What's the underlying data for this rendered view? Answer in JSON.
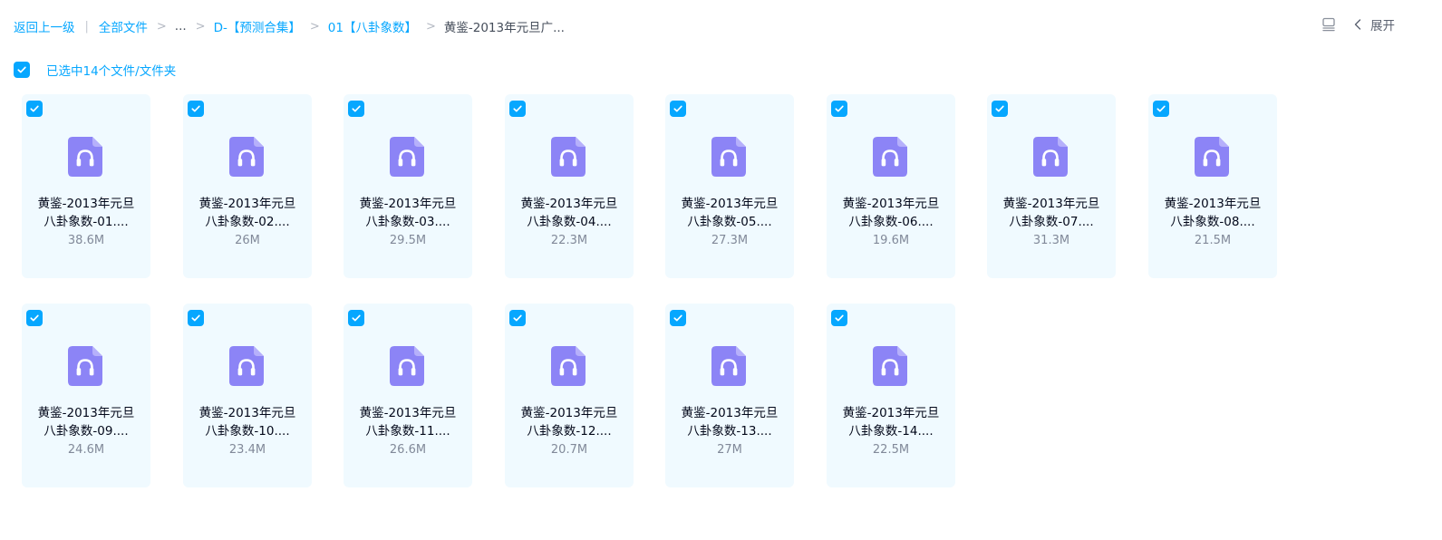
{
  "breadcrumb": {
    "back": "返回上一级",
    "all_files": "全部文件",
    "ellipsis": "...",
    "folder1": "D-【预测合集】",
    "folder2": "01【八卦象数】",
    "current": "黄鉴-2013年元旦广...",
    "separator": ">",
    "divider": "|"
  },
  "toolbar": {
    "expand_label": "展开",
    "layout_icon": "list-layout-icon",
    "expand_icon": "chevron-left-icon"
  },
  "selection": {
    "text": "已选中14个文件/文件夹",
    "checked": true
  },
  "colors": {
    "accent": "#06a7ff",
    "card_bg": "#f0faff",
    "file_icon": "#8c84f6"
  },
  "files": [
    {
      "line1": "黄鉴-2013年元旦",
      "line2": "八卦象数-01....",
      "size": "38.6M",
      "icon": "audio-file-icon",
      "checked": true
    },
    {
      "line1": "黄鉴-2013年元旦",
      "line2": "八卦象数-02....",
      "size": "26M",
      "icon": "audio-file-icon",
      "checked": true
    },
    {
      "line1": "黄鉴-2013年元旦",
      "line2": "八卦象数-03....",
      "size": "29.5M",
      "icon": "audio-file-icon",
      "checked": true
    },
    {
      "line1": "黄鉴-2013年元旦",
      "line2": "八卦象数-04....",
      "size": "22.3M",
      "icon": "audio-file-icon",
      "checked": true
    },
    {
      "line1": "黄鉴-2013年元旦",
      "line2": "八卦象数-05....",
      "size": "27.3M",
      "icon": "audio-file-icon",
      "checked": true
    },
    {
      "line1": "黄鉴-2013年元旦",
      "line2": "八卦象数-06....",
      "size": "19.6M",
      "icon": "audio-file-icon",
      "checked": true
    },
    {
      "line1": "黄鉴-2013年元旦",
      "line2": "八卦象数-07....",
      "size": "31.3M",
      "icon": "audio-file-icon",
      "checked": true
    },
    {
      "line1": "黄鉴-2013年元旦",
      "line2": "八卦象数-08....",
      "size": "21.5M",
      "icon": "audio-file-icon",
      "checked": true
    },
    {
      "line1": "黄鉴-2013年元旦",
      "line2": "八卦象数-09....",
      "size": "24.6M",
      "icon": "audio-file-icon",
      "checked": true
    },
    {
      "line1": "黄鉴-2013年元旦",
      "line2": "八卦象数-10....",
      "size": "23.4M",
      "icon": "audio-file-icon",
      "checked": true
    },
    {
      "line1": "黄鉴-2013年元旦",
      "line2": "八卦象数-11....",
      "size": "26.6M",
      "icon": "audio-file-icon",
      "checked": true
    },
    {
      "line1": "黄鉴-2013年元旦",
      "line2": "八卦象数-12....",
      "size": "20.7M",
      "icon": "audio-file-icon",
      "checked": true
    },
    {
      "line1": "黄鉴-2013年元旦",
      "line2": "八卦象数-13....",
      "size": "27M",
      "icon": "audio-file-icon",
      "checked": true
    },
    {
      "line1": "黄鉴-2013年元旦",
      "line2": "八卦象数-14....",
      "size": "22.5M",
      "icon": "audio-file-icon",
      "checked": true
    }
  ]
}
